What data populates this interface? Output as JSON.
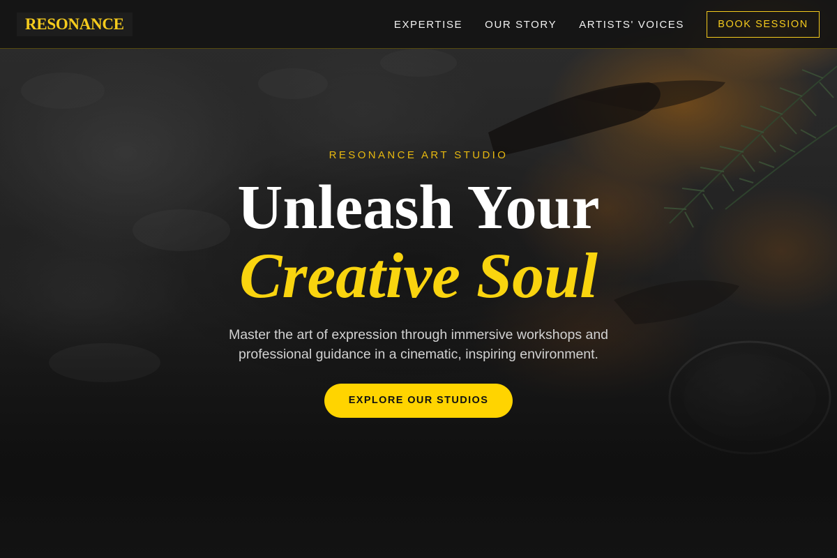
{
  "nav": {
    "brand": "RESONANCE",
    "links": [
      "EXPERTISE",
      "OUR STORY",
      "ARTISTS' VOICES"
    ],
    "book_label": "BOOK SESSION"
  },
  "hero": {
    "eyebrow": "RESONANCE ART STUDIO",
    "headline_line1": "Unleash Your",
    "headline_line2": "Creative Soul",
    "subtext": "Master the art of expression through immersive workshops and professional guidance in a cinematic, inspiring environment.",
    "cta_label": "EXPLORE OUR STUDIOS"
  },
  "colors": {
    "accent": "#FFD400",
    "background": "#141414",
    "text": "#FFFFFF"
  }
}
